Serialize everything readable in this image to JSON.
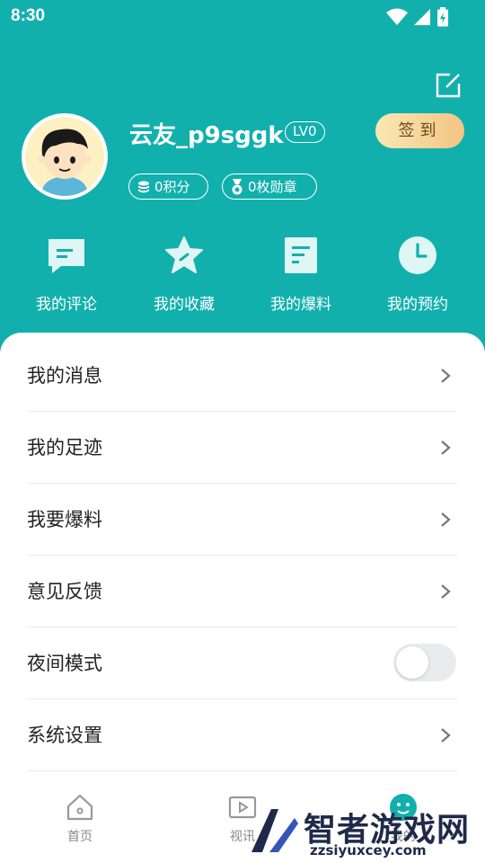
{
  "status_bar": {
    "time": "8:30"
  },
  "profile": {
    "username": "云友_p9sggk",
    "level": "LV0",
    "checkin_label": "签到",
    "points_label": "0积分",
    "medals_label": "0枚勋章"
  },
  "quick_actions": [
    {
      "label": "我的评论",
      "icon": "comment-icon"
    },
    {
      "label": "我的收藏",
      "icon": "star-icon"
    },
    {
      "label": "我的爆料",
      "icon": "document-icon"
    },
    {
      "label": "我的预约",
      "icon": "clock-icon"
    }
  ],
  "menu": [
    {
      "label": "我的消息",
      "type": "link"
    },
    {
      "label": "我的足迹",
      "type": "link"
    },
    {
      "label": "我要爆料",
      "type": "link"
    },
    {
      "label": "意见反馈",
      "type": "link"
    },
    {
      "label": "夜间模式",
      "type": "toggle",
      "on": false
    },
    {
      "label": "系统设置",
      "type": "link"
    }
  ],
  "tabbar": [
    {
      "label": "首页",
      "icon": "home-icon"
    },
    {
      "label": "视讯",
      "icon": "video-icon"
    },
    {
      "label": "我的",
      "icon": "profile-icon"
    }
  ],
  "watermark": {
    "text": "智者游戏网",
    "domain": "zzsiyuxcey.com"
  },
  "colors": {
    "primary": "#12b0ad",
    "checkin_gradient_start": "#fbe7b4",
    "checkin_gradient_end": "#f3c583"
  }
}
